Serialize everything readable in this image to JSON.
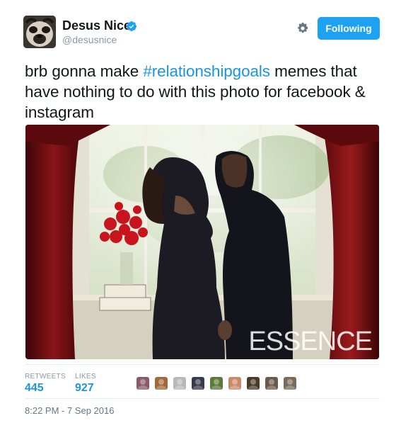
{
  "user": {
    "name": "Desus Nice",
    "handle": "@desusnice",
    "verified": true,
    "avatar": "bulldog-mask-avatar"
  },
  "actions": {
    "settings_icon": "gear-icon",
    "follow_label": "Following",
    "follow_color": "#1da1f2"
  },
  "tweet": {
    "text_before": "brb gonna make ",
    "hashtag": "#relationshipgoals",
    "text_after": " memes that have nothing to do with this photo for facebook & instagram",
    "hashtag_color": "#1b95e0"
  },
  "media": {
    "watermark": "ESSENCE",
    "description_icon": "photo-image"
  },
  "stats": {
    "retweets_label": "RETWEETS",
    "retweets_count": "445",
    "likes_label": "LIKES",
    "likes_count": "927"
  },
  "likers": [
    {
      "name": "liker-avatar-1",
      "color": "#8a5a6a"
    },
    {
      "name": "liker-avatar-2",
      "color": "#a06a3a"
    },
    {
      "name": "liker-avatar-3",
      "color": "#b8b8b8"
    },
    {
      "name": "liker-avatar-4",
      "color": "#3a3a4a"
    },
    {
      "name": "liker-avatar-5",
      "color": "#5a7a3a"
    },
    {
      "name": "liker-avatar-6",
      "color": "#c88a6a"
    },
    {
      "name": "liker-avatar-7",
      "color": "#4a3a2a"
    },
    {
      "name": "liker-avatar-8",
      "color": "#6a5a4a"
    },
    {
      "name": "liker-avatar-9",
      "color": "#7a6a5a"
    }
  ],
  "meta": {
    "timestamp": "8:22 PM - 7 Sep 2016"
  }
}
